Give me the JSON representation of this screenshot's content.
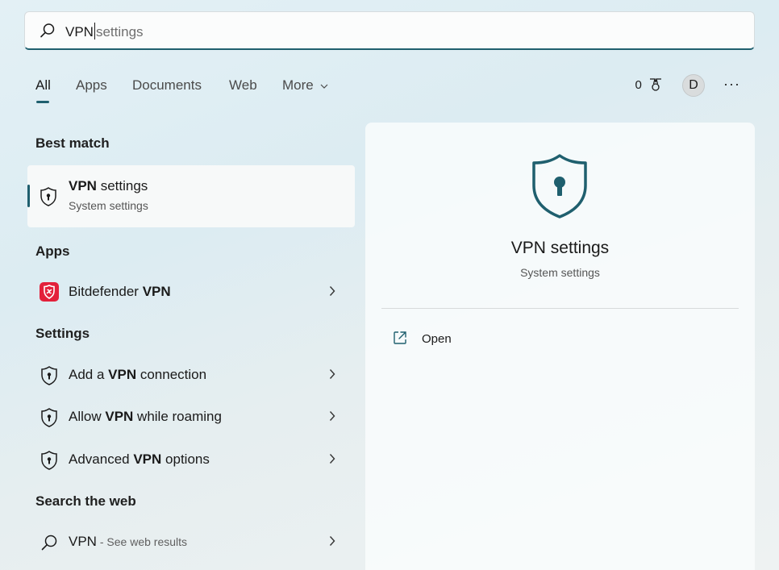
{
  "search": {
    "typed": "VPN",
    "suggestion": "settings"
  },
  "tabs": [
    {
      "label": "All",
      "active": true
    },
    {
      "label": "Apps"
    },
    {
      "label": "Documents"
    },
    {
      "label": "Web"
    },
    {
      "label": "More"
    }
  ],
  "toolbar": {
    "points": "0",
    "avatar_initial": "D",
    "more_glyph": "···"
  },
  "sections": {
    "best_match": "Best match",
    "apps": "Apps",
    "settings": "Settings",
    "search_web": "Search the web"
  },
  "best_match": {
    "title_bold": "VPN",
    "title_rest": " settings",
    "subtitle": "System settings"
  },
  "apps": [
    {
      "prefix": "Bitdefender ",
      "bold": "VPN",
      "suffix": ""
    }
  ],
  "settings_items": [
    {
      "prefix": "Add a ",
      "bold": "VPN",
      "suffix": " connection"
    },
    {
      "prefix": "Allow ",
      "bold": "VPN",
      "suffix": " while roaming"
    },
    {
      "prefix": "Advanced ",
      "bold": "VPN",
      "suffix": " options"
    }
  ],
  "web": {
    "query": "VPN",
    "suffix": " - See web results"
  },
  "detail": {
    "title": "VPN settings",
    "subtitle": "System settings",
    "open_label": "Open"
  },
  "colors": {
    "accent": "#1f5f6e",
    "bitdefender_red": "#e3203a"
  }
}
